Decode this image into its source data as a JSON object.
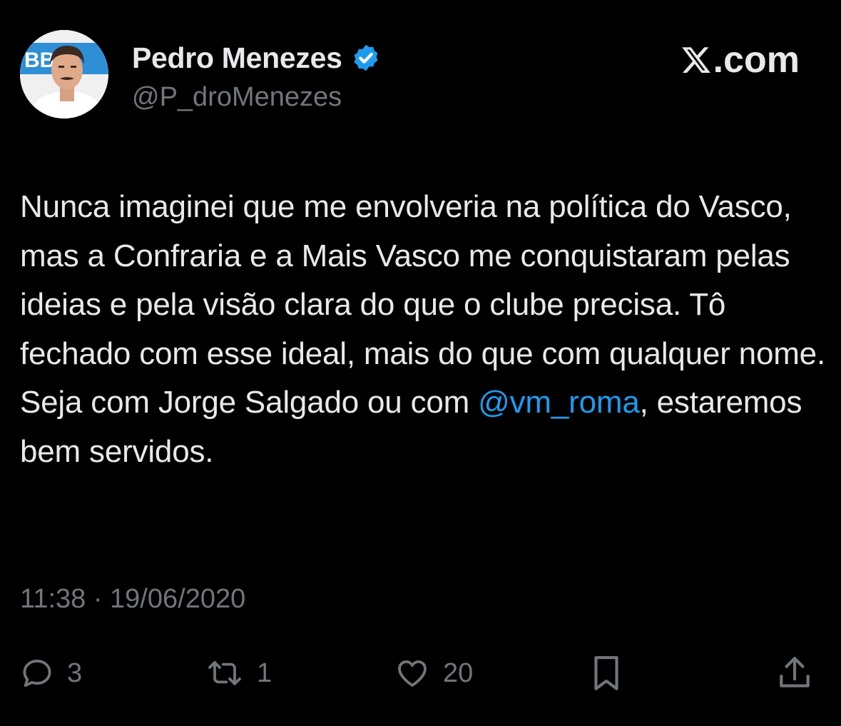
{
  "author": {
    "display_name": "Pedro Menezes",
    "handle": "@P_droMenezes",
    "verified": true,
    "avatar_badge_text": "BBB"
  },
  "brand": {
    "logo_icon": "x-logo-icon",
    "suffix": ".com"
  },
  "tweet": {
    "text_before_mention": "Nunca imaginei que me envolveria na política do Vasco, mas a Confraria e a Mais Vasco me conquistaram pelas ideias e pela visão clara do que o clube precisa. Tô fechado com esse ideal, mais do que com qualquer nome. Seja com Jorge Salgado ou com ",
    "mention": "@vm_roma",
    "text_after_mention": ", estaremos bem servidos.",
    "timestamp": "11:38 · 19/06/2020"
  },
  "actions": {
    "reply": {
      "icon": "reply-icon",
      "count": "3"
    },
    "repost": {
      "icon": "repost-icon",
      "count": "1"
    },
    "like": {
      "icon": "heart-icon",
      "count": "20"
    },
    "bookmark": {
      "icon": "bookmark-icon"
    },
    "share": {
      "icon": "share-icon"
    }
  },
  "colors": {
    "background": "#000000",
    "primary_text": "#e7e9ea",
    "secondary_text": "#71767b",
    "accent": "#1d9bf0"
  }
}
